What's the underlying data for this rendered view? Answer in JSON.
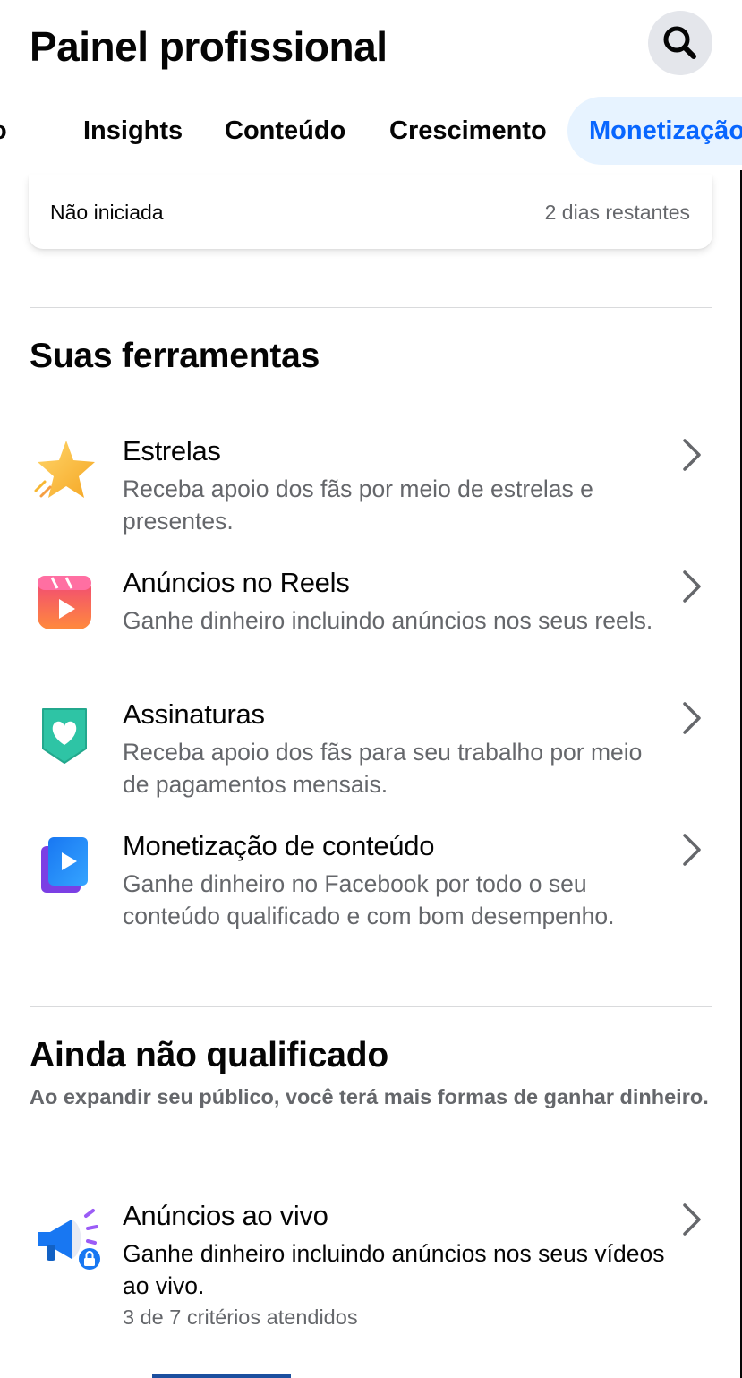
{
  "header": {
    "title": "Painel profissional",
    "search_icon": "search-icon"
  },
  "tabs": [
    {
      "label": "o",
      "active": false
    },
    {
      "label": "Insights",
      "active": false
    },
    {
      "label": "Conteúdo",
      "active": false
    },
    {
      "label": "Crescimento",
      "active": false
    },
    {
      "label": "Monetização",
      "active": true
    }
  ],
  "status_card": {
    "status": "Não iniciada",
    "remaining": "2 dias restantes"
  },
  "tools_section": {
    "title": "Suas ferramentas",
    "items": [
      {
        "title": "Estrelas",
        "desc": "Receba apoio dos fãs por meio de estrelas e presentes.",
        "icon": "star-icon"
      },
      {
        "title": "Anúncios no Reels",
        "desc": "Ganhe dinheiro incluindo anúncios nos seus reels.",
        "icon": "reels-icon"
      },
      {
        "title": "Assinaturas",
        "desc": "Receba apoio dos fãs para seu trabalho por meio de pagamentos mensais.",
        "icon": "heart-badge-icon"
      },
      {
        "title": "Monetização de conteúdo",
        "desc": "Ganhe dinheiro no Facebook por todo o seu conteúdo qualificado e com bom desempenho.",
        "icon": "play-icon"
      }
    ]
  },
  "not_qualified": {
    "title": "Ainda não qualificado",
    "subtitle": "Ao expandir seu público, você terá mais formas de ganhar dinheiro.",
    "items": [
      {
        "title": "Anúncios ao vivo",
        "desc": "Ganhe dinheiro incluindo anúncios nos seus vídeos ao vivo.",
        "criteria": "3 de 7 critérios atendidos",
        "icon": "megaphone-lock-icon"
      }
    ]
  },
  "colors": {
    "accent": "#0866ff",
    "accent_bg": "#e7f3ff",
    "secondary_text": "#65676b"
  }
}
